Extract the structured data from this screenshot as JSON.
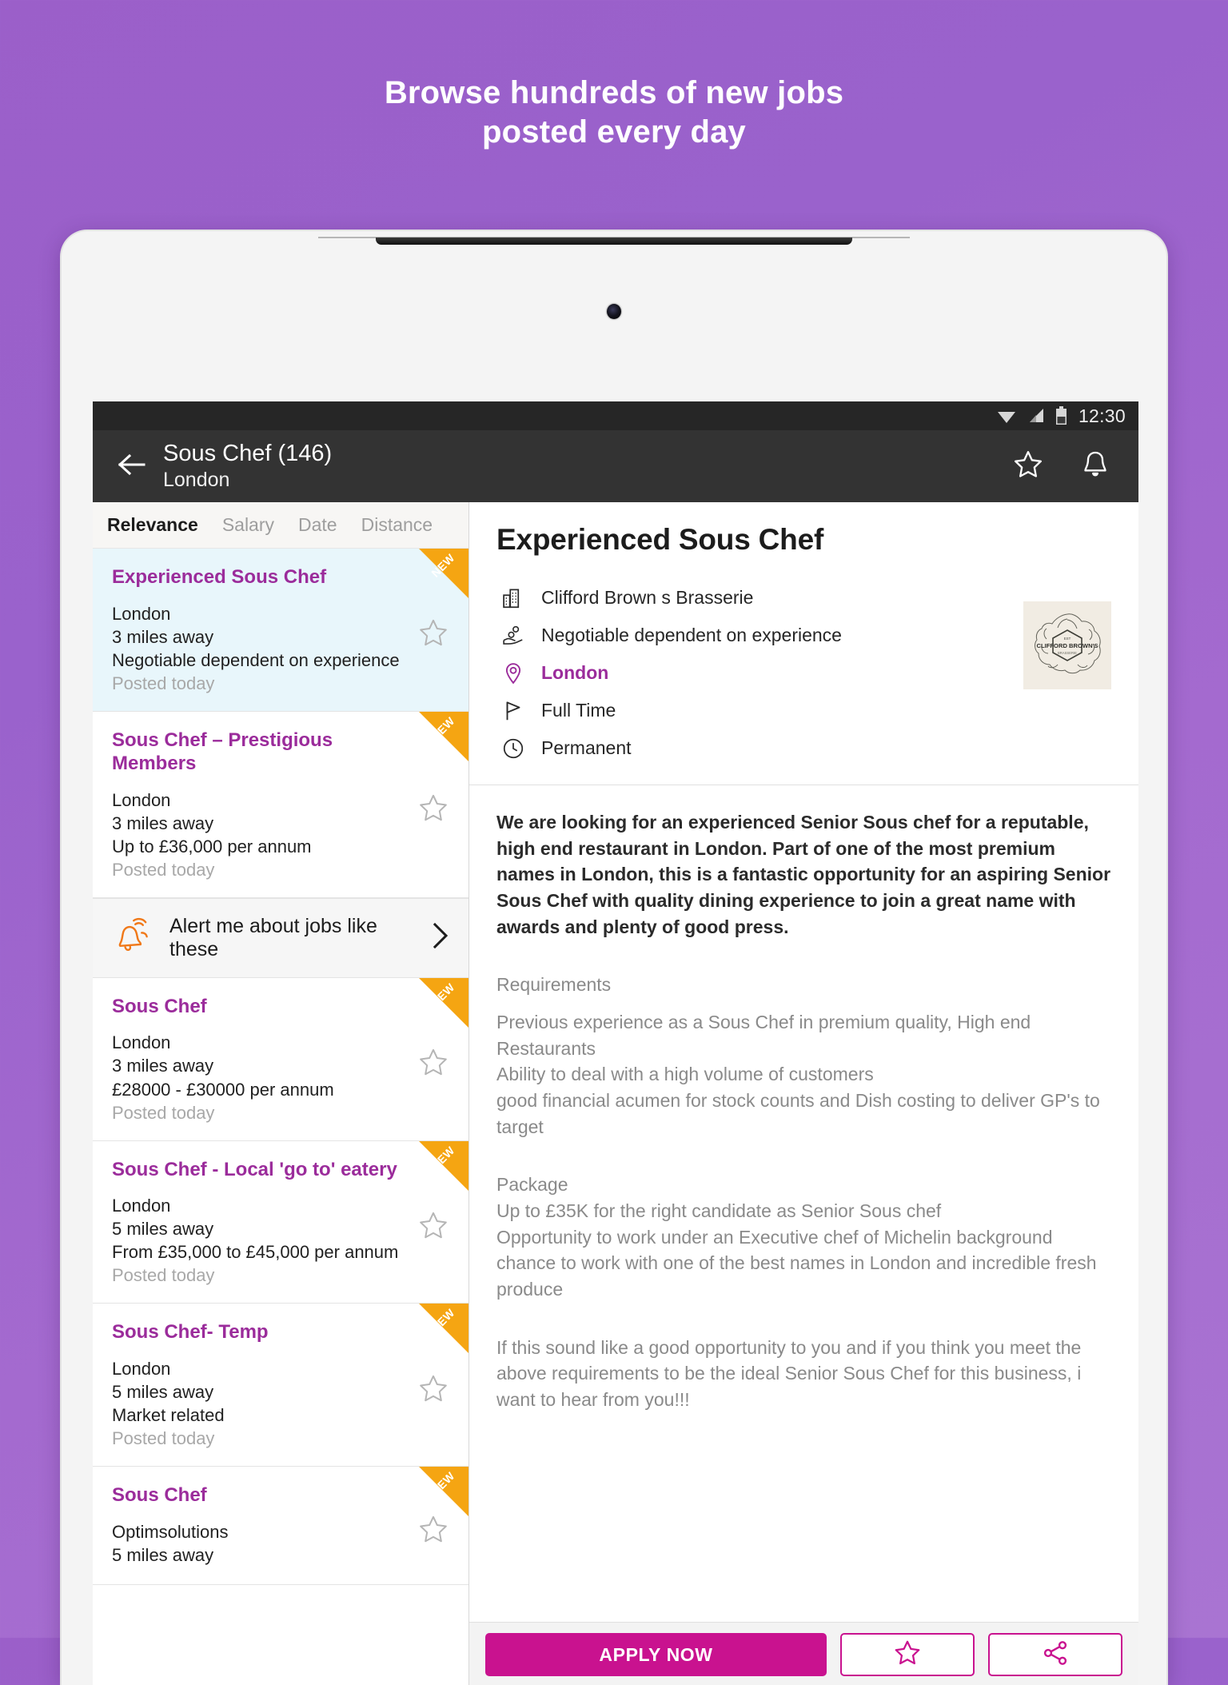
{
  "promo": {
    "line1": "Browse hundreds of new jobs",
    "line2": "posted every day"
  },
  "status_bar": {
    "wifi_icon": "wifi-icon",
    "signal_icon": "cellular-signal-icon",
    "battery_icon": "battery-icon",
    "time": "12:30"
  },
  "app_bar": {
    "back_icon": "back-arrow-icon",
    "title": "Sous Chef (146)",
    "subtitle": "London",
    "star_icon": "star-outline-icon",
    "bell_icon": "bell-icon"
  },
  "sort_tabs": [
    {
      "label": "Relevance",
      "active": true
    },
    {
      "label": "Salary",
      "active": false
    },
    {
      "label": "Date",
      "active": false
    },
    {
      "label": "Distance",
      "active": false
    }
  ],
  "job_list": [
    {
      "title": "Experienced Sous Chef",
      "location": "London",
      "distance": "3 miles away",
      "salary": "Negotiable dependent on experience",
      "posted": "Posted today",
      "badge": "NEW",
      "selected": true
    },
    {
      "title": "Sous Chef – Prestigious Members",
      "location": "London",
      "distance": "3 miles away",
      "salary": "Up to £36,000 per annum",
      "posted": "Posted today",
      "badge": "NEW",
      "selected": false
    },
    {
      "title": "Sous Chef",
      "location": "London",
      "distance": "3 miles away",
      "salary": "£28000 - £30000 per annum",
      "posted": "Posted today",
      "badge": "NEW",
      "selected": false
    },
    {
      "title": "Sous Chef - Local 'go to' eatery",
      "location": "London",
      "distance": "5 miles away",
      "salary": "From £35,000 to £45,000 per annum",
      "posted": "Posted today",
      "badge": "NEW",
      "selected": false
    },
    {
      "title": "Sous Chef- Temp",
      "location": "London",
      "distance": "5 miles away",
      "salary": "Market related",
      "posted": "Posted today",
      "badge": "NEW",
      "selected": false
    },
    {
      "title": "Sous Chef",
      "location": "Optimsolutions",
      "distance": "5 miles away",
      "salary": "",
      "posted": "",
      "badge": "NEW",
      "selected": false
    }
  ],
  "alert_row": {
    "bell_icon": "alert-bell-icon",
    "label": "Alert me about jobs like these",
    "chevron_icon": "chevron-right-icon"
  },
  "detail": {
    "title": "Experienced Sous Chef",
    "facts": [
      {
        "icon": "building-icon",
        "text": "Clifford Brown s Brasserie",
        "accent": false
      },
      {
        "icon": "salary-hand-icon",
        "text": "Negotiable dependent on experience",
        "accent": false
      },
      {
        "icon": "location-pin-icon",
        "text": "London",
        "accent": true
      },
      {
        "icon": "flag-icon",
        "text": "Full Time",
        "accent": false
      },
      {
        "icon": "clock-icon",
        "text": "Permanent",
        "accent": false
      }
    ],
    "company_logo": {
      "icon": "company-logo-image",
      "label": "CLIFFORD BROWN'S"
    },
    "lead": "We are looking for an experienced Senior Sous chef for a reputable, high end restaurant in London. Part of one of the most premium names in London, this is a fantastic opportunity for an aspiring Senior Sous Chef with quality dining experience to join a great name with awards and plenty of good press.",
    "requirements_heading": "Requirements",
    "requirements_body": "Previous experience as a Sous Chef in premium quality, High end Restaurants\nAbility to deal with a high volume of customers\ngood financial acumen for stock counts and Dish costing to deliver GP's to target",
    "package_heading": "Package",
    "package_body": "Up to £35K for the right candidate as Senior Sous chef\nOpportunity to work under an Executive chef of Michelin background\nchance to work with one of the best names in London and incredible fresh produce",
    "closing": "If this sound like a good opportunity to you and if you think you meet the above requirements to be the ideal Senior Sous Chef for this business, i want to hear from you!!!"
  },
  "action_bar": {
    "apply_label": "APPLY NOW",
    "save_icon": "star-outline-icon",
    "share_icon": "share-icon"
  },
  "colors": {
    "brand_purple": "#9B2C9B",
    "apply_magenta": "#C9128F",
    "badge_orange": "#F5A512",
    "alert_orange": "#F07818",
    "background_purple": "#9B5FC9",
    "selected_card": "#e8f6fb"
  }
}
